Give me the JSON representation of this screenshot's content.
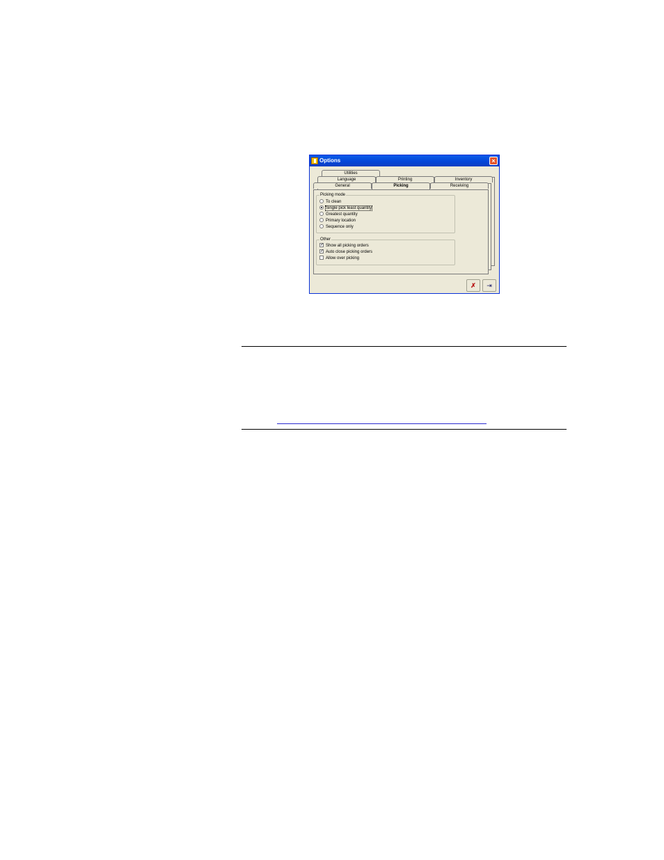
{
  "window": {
    "title": "Options",
    "close_glyph": "×"
  },
  "tabs": {
    "row3": [
      "Utilities"
    ],
    "row2": [
      "Language",
      "Printing",
      "Inventory"
    ],
    "row1": [
      "General",
      "Picking",
      "Receiving"
    ],
    "active": "Picking"
  },
  "picking_mode": {
    "label": "Picking mode",
    "options": [
      {
        "label": "To clean",
        "selected": false
      },
      {
        "label": "Single pick least quantity",
        "selected": true
      },
      {
        "label": "Greatest quantity",
        "selected": false
      },
      {
        "label": "Primary location",
        "selected": false
      },
      {
        "label": "Sequence only",
        "selected": false
      }
    ]
  },
  "other": {
    "label": "Other",
    "options": [
      {
        "label": "Show all picking orders",
        "checked": true
      },
      {
        "label": "Auto close picking orders",
        "checked": true
      },
      {
        "label": "Allow over picking",
        "checked": false
      }
    ]
  },
  "buttons": {
    "cancel_icon": "✗",
    "exit_icon": "⇥"
  },
  "colors": {
    "title_bar": "#0446d9",
    "dialog_bg": "#ece9d8",
    "close_btn": "#e4552b",
    "cancel_icon": "#b81414"
  }
}
